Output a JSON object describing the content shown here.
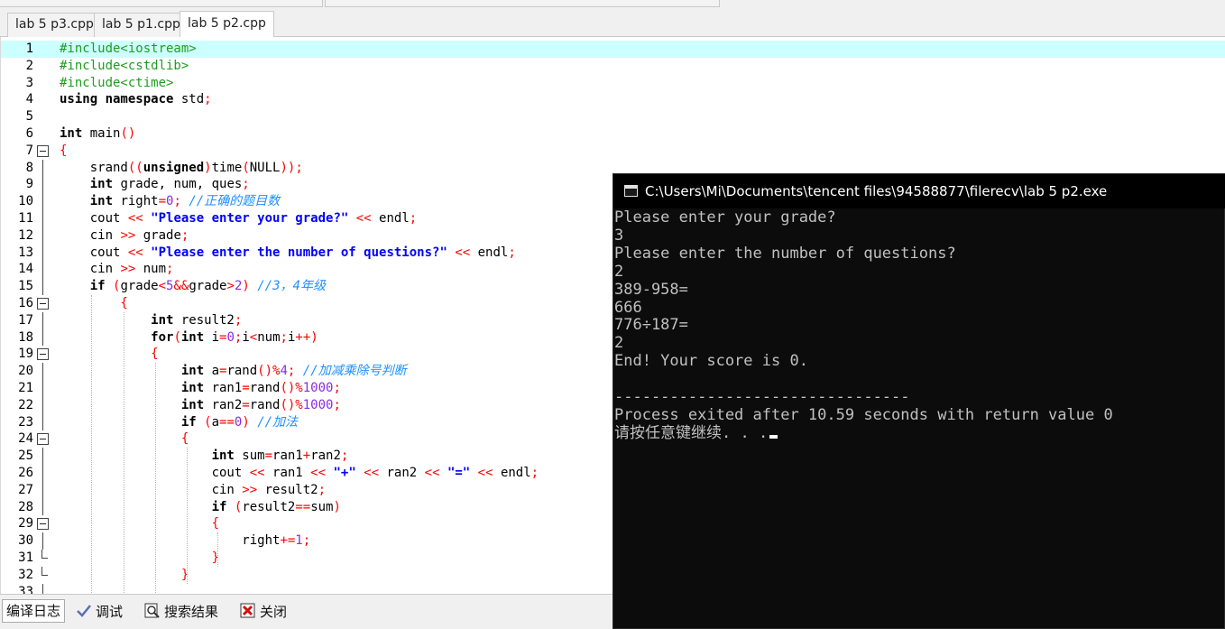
{
  "tabs": [
    {
      "label": "lab 5 p3.cpp",
      "active": false
    },
    {
      "label": "lab 5 p1.cpp",
      "active": false
    },
    {
      "label": "lab 5 p2.cpp",
      "active": true
    }
  ],
  "lines": [
    {
      "n": "1",
      "segs": [
        {
          "t": "#include<iostream>",
          "c": "pp"
        }
      ]
    },
    {
      "n": "2",
      "segs": [
        {
          "t": "#include<cstdlib>",
          "c": "pp"
        }
      ]
    },
    {
      "n": "3",
      "segs": [
        {
          "t": "#include<ctime>",
          "c": "pp"
        }
      ]
    },
    {
      "n": "4",
      "segs": [
        {
          "t": "using namespace ",
          "c": "kw"
        },
        {
          "t": "std",
          "c": "id"
        },
        {
          "t": ";",
          "c": "sym"
        }
      ]
    },
    {
      "n": "5",
      "segs": []
    },
    {
      "n": "6",
      "segs": [
        {
          "t": "int ",
          "c": "kw"
        },
        {
          "t": "main",
          "c": "id"
        },
        {
          "t": "()",
          "c": "sym"
        }
      ]
    },
    {
      "n": "7",
      "segs": [
        {
          "t": "{",
          "c": "sym"
        }
      ]
    },
    {
      "n": "8",
      "segs": [
        {
          "t": "    srand",
          "c": "id"
        },
        {
          "t": "((",
          "c": "sym"
        },
        {
          "t": "unsigned",
          "c": "kw"
        },
        {
          "t": ")",
          "c": "sym"
        },
        {
          "t": "time",
          "c": "id"
        },
        {
          "t": "(",
          "c": "sym"
        },
        {
          "t": "NULL",
          "c": "id"
        },
        {
          "t": "));",
          "c": "sym"
        }
      ]
    },
    {
      "n": "9",
      "segs": [
        {
          "t": "    int ",
          "c": "kw"
        },
        {
          "t": "grade, num, ques",
          "c": "id"
        },
        {
          "t": ";",
          "c": "sym"
        }
      ]
    },
    {
      "n": "10",
      "segs": [
        {
          "t": "    int ",
          "c": "kw"
        },
        {
          "t": "right",
          "c": "id"
        },
        {
          "t": "=",
          "c": "sym"
        },
        {
          "t": "0",
          "c": "num"
        },
        {
          "t": "; ",
          "c": "sym"
        },
        {
          "t": "//正确的题目数",
          "c": "cmt"
        }
      ]
    },
    {
      "n": "11",
      "segs": [
        {
          "t": "    cout ",
          "c": "id"
        },
        {
          "t": "<< ",
          "c": "sym"
        },
        {
          "t": "\"Please enter your grade?\"",
          "c": "str"
        },
        {
          "t": " << ",
          "c": "sym"
        },
        {
          "t": "endl",
          "c": "id"
        },
        {
          "t": ";",
          "c": "sym"
        }
      ]
    },
    {
      "n": "12",
      "segs": [
        {
          "t": "    cin ",
          "c": "id"
        },
        {
          "t": ">> ",
          "c": "sym"
        },
        {
          "t": "grade",
          "c": "id"
        },
        {
          "t": ";",
          "c": "sym"
        }
      ]
    },
    {
      "n": "13",
      "segs": [
        {
          "t": "    cout ",
          "c": "id"
        },
        {
          "t": "<< ",
          "c": "sym"
        },
        {
          "t": "\"Please enter the number of questions?\"",
          "c": "str"
        },
        {
          "t": " << ",
          "c": "sym"
        },
        {
          "t": "endl",
          "c": "id"
        },
        {
          "t": ";",
          "c": "sym"
        }
      ]
    },
    {
      "n": "14",
      "segs": [
        {
          "t": "    cin ",
          "c": "id"
        },
        {
          "t": ">> ",
          "c": "sym"
        },
        {
          "t": "num",
          "c": "id"
        },
        {
          "t": ";",
          "c": "sym"
        }
      ]
    },
    {
      "n": "15",
      "segs": [
        {
          "t": "    if ",
          "c": "kw"
        },
        {
          "t": "(",
          "c": "sym"
        },
        {
          "t": "grade",
          "c": "id"
        },
        {
          "t": "<",
          "c": "sym"
        },
        {
          "t": "5",
          "c": "num"
        },
        {
          "t": "&&",
          "c": "sym"
        },
        {
          "t": "grade",
          "c": "id"
        },
        {
          "t": ">",
          "c": "sym"
        },
        {
          "t": "2",
          "c": "num"
        },
        {
          "t": ") ",
          "c": "sym"
        },
        {
          "t": "//3，4年级",
          "c": "cmt"
        }
      ]
    },
    {
      "n": "16",
      "segs": [
        {
          "t": "        {",
          "c": "sym"
        }
      ]
    },
    {
      "n": "17",
      "segs": [
        {
          "t": "            int ",
          "c": "kw"
        },
        {
          "t": "result2",
          "c": "id"
        },
        {
          "t": ";",
          "c": "sym"
        }
      ]
    },
    {
      "n": "18",
      "segs": [
        {
          "t": "            for",
          "c": "kw"
        },
        {
          "t": "(",
          "c": "sym"
        },
        {
          "t": "int ",
          "c": "kw"
        },
        {
          "t": "i",
          "c": "id"
        },
        {
          "t": "=",
          "c": "sym"
        },
        {
          "t": "0",
          "c": "num"
        },
        {
          "t": ";",
          "c": "sym"
        },
        {
          "t": "i",
          "c": "id"
        },
        {
          "t": "<",
          "c": "sym"
        },
        {
          "t": "num",
          "c": "id"
        },
        {
          "t": ";",
          "c": "sym"
        },
        {
          "t": "i",
          "c": "id"
        },
        {
          "t": "++)",
          "c": "sym"
        }
      ]
    },
    {
      "n": "19",
      "segs": [
        {
          "t": "            {",
          "c": "sym"
        }
      ]
    },
    {
      "n": "20",
      "segs": [
        {
          "t": "                int ",
          "c": "kw"
        },
        {
          "t": "a",
          "c": "id"
        },
        {
          "t": "=",
          "c": "sym"
        },
        {
          "t": "rand",
          "c": "id"
        },
        {
          "t": "()%",
          "c": "sym"
        },
        {
          "t": "4",
          "c": "num"
        },
        {
          "t": "; ",
          "c": "sym"
        },
        {
          "t": "//加减乘除号判断",
          "c": "cmt"
        }
      ]
    },
    {
      "n": "21",
      "segs": [
        {
          "t": "                int ",
          "c": "kw"
        },
        {
          "t": "ran1",
          "c": "id"
        },
        {
          "t": "=",
          "c": "sym"
        },
        {
          "t": "rand",
          "c": "id"
        },
        {
          "t": "()%",
          "c": "sym"
        },
        {
          "t": "1000",
          "c": "num"
        },
        {
          "t": ";",
          "c": "sym"
        }
      ]
    },
    {
      "n": "22",
      "segs": [
        {
          "t": "                int ",
          "c": "kw"
        },
        {
          "t": "ran2",
          "c": "id"
        },
        {
          "t": "=",
          "c": "sym"
        },
        {
          "t": "rand",
          "c": "id"
        },
        {
          "t": "()%",
          "c": "sym"
        },
        {
          "t": "1000",
          "c": "num"
        },
        {
          "t": ";",
          "c": "sym"
        }
      ]
    },
    {
      "n": "23",
      "segs": [
        {
          "t": "                if ",
          "c": "kw"
        },
        {
          "t": "(",
          "c": "sym"
        },
        {
          "t": "a",
          "c": "id"
        },
        {
          "t": "==",
          "c": "sym"
        },
        {
          "t": "0",
          "c": "num"
        },
        {
          "t": ") ",
          "c": "sym"
        },
        {
          "t": "//加法",
          "c": "cmt"
        }
      ]
    },
    {
      "n": "24",
      "segs": [
        {
          "t": "                {",
          "c": "sym"
        }
      ]
    },
    {
      "n": "25",
      "segs": [
        {
          "t": "                    int ",
          "c": "kw"
        },
        {
          "t": "sum",
          "c": "id"
        },
        {
          "t": "=",
          "c": "sym"
        },
        {
          "t": "ran1",
          "c": "id"
        },
        {
          "t": "+",
          "c": "sym"
        },
        {
          "t": "ran2",
          "c": "id"
        },
        {
          "t": ";",
          "c": "sym"
        }
      ]
    },
    {
      "n": "26",
      "segs": [
        {
          "t": "                    cout ",
          "c": "id"
        },
        {
          "t": "<< ",
          "c": "sym"
        },
        {
          "t": "ran1 ",
          "c": "id"
        },
        {
          "t": "<< ",
          "c": "sym"
        },
        {
          "t": "\"+\"",
          "c": "str"
        },
        {
          "t": " << ",
          "c": "sym"
        },
        {
          "t": "ran2 ",
          "c": "id"
        },
        {
          "t": "<< ",
          "c": "sym"
        },
        {
          "t": "\"=\"",
          "c": "str"
        },
        {
          "t": " << ",
          "c": "sym"
        },
        {
          "t": "endl",
          "c": "id"
        },
        {
          "t": ";",
          "c": "sym"
        }
      ]
    },
    {
      "n": "27",
      "segs": [
        {
          "t": "                    cin ",
          "c": "id"
        },
        {
          "t": ">> ",
          "c": "sym"
        },
        {
          "t": "result2",
          "c": "id"
        },
        {
          "t": ";",
          "c": "sym"
        }
      ]
    },
    {
      "n": "28",
      "segs": [
        {
          "t": "                    if ",
          "c": "kw"
        },
        {
          "t": "(",
          "c": "sym"
        },
        {
          "t": "result2",
          "c": "id"
        },
        {
          "t": "==",
          "c": "sym"
        },
        {
          "t": "sum",
          "c": "id"
        },
        {
          "t": ")",
          "c": "sym"
        }
      ]
    },
    {
      "n": "29",
      "segs": [
        {
          "t": "                    {",
          "c": "sym"
        }
      ]
    },
    {
      "n": "30",
      "segs": [
        {
          "t": "                        right",
          "c": "id"
        },
        {
          "t": "+=",
          "c": "sym"
        },
        {
          "t": "1",
          "c": "num"
        },
        {
          "t": ";",
          "c": "sym"
        }
      ]
    },
    {
      "n": "31",
      "segs": [
        {
          "t": "                    }",
          "c": "sym"
        }
      ]
    },
    {
      "n": "32",
      "segs": [
        {
          "t": "                }",
          "c": "sym"
        }
      ]
    },
    {
      "n": "33",
      "segs": []
    }
  ],
  "bottom_tabs": [
    {
      "label": "编译日志",
      "icon": "compile-log-icon",
      "active": true
    },
    {
      "label": "调试",
      "icon": "debug-check-icon",
      "active": false
    },
    {
      "label": "搜索结果",
      "icon": "search-results-icon",
      "active": false
    },
    {
      "label": "关闭",
      "icon": "close-icon",
      "active": false
    }
  ],
  "console": {
    "title": "C:\\Users\\Mi\\Documents\\tencent files\\94588877\\filerecv\\lab 5 p2.exe",
    "lines": [
      "Please enter your grade?",
      "3",
      "Please enter the number of questions?",
      "2",
      "389-958=",
      "666",
      "776÷187=",
      "2",
      "End! Your score is 0.",
      "",
      "--------------------------------",
      "Process exited after 10.59 seconds with return value 0",
      "请按任意键继续. . ."
    ]
  }
}
